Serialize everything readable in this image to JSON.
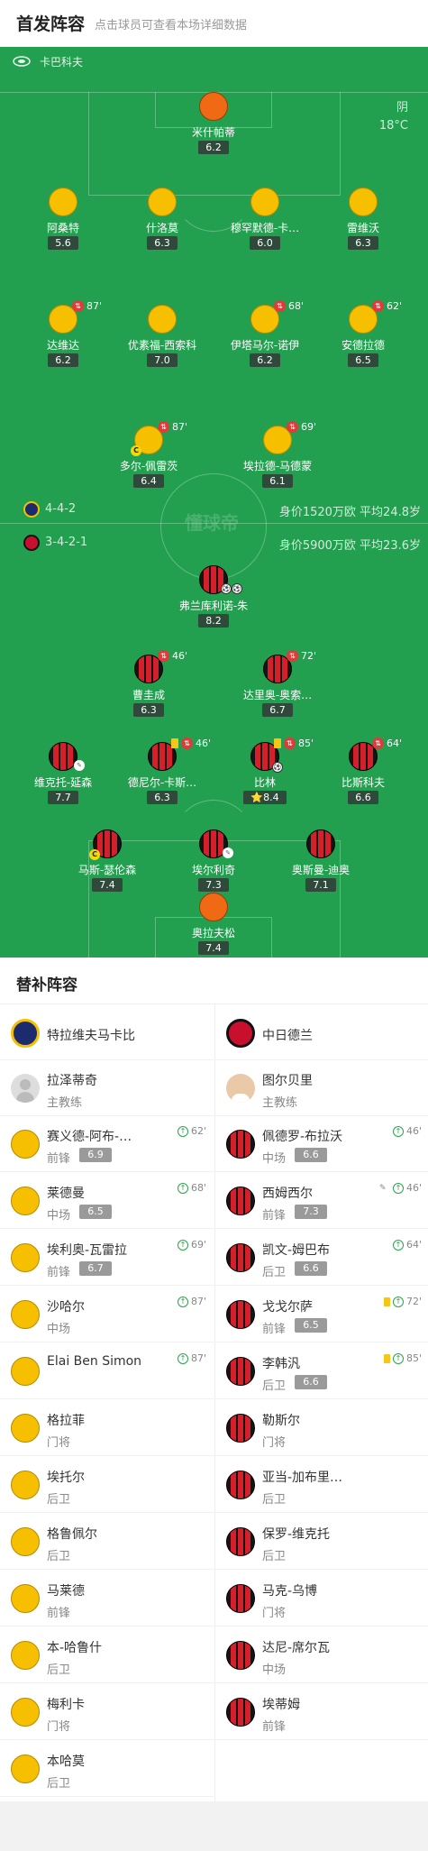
{
  "header": {
    "title": "首发阵容",
    "subtitle": "点击球员可查看本场详细数据"
  },
  "stadium": {
    "name": "卡巴科夫"
  },
  "weather": {
    "condition": "阴",
    "temperature": "18°C"
  },
  "watermark": "懂球帝",
  "home": {
    "name": "特拉维夫马卡比",
    "formation": "4-4-2",
    "info": "身价1520万欧 平均24.8岁",
    "colors": {
      "shirt": "#f6bf00",
      "keeper": "#f06a16"
    },
    "coach": {
      "name": "拉泽蒂奇",
      "role": "主教练"
    },
    "keeper": {
      "name": "米什帕蒂",
      "score": "6.2"
    },
    "defenders": [
      {
        "name": "阿桑特",
        "score": "5.6"
      },
      {
        "name": "什洛莫",
        "score": "6.3"
      },
      {
        "name": "穆罕默德-卡…",
        "score": "6.0"
      },
      {
        "name": "雷维沃",
        "score": "6.3"
      }
    ],
    "midfielders": [
      {
        "name": "达维达",
        "score": "6.2",
        "sub_min": "87'"
      },
      {
        "name": "优素福-西索科",
        "score": "7.0"
      },
      {
        "name": "伊塔马尔-诺伊",
        "score": "6.2",
        "sub_min": "68'"
      },
      {
        "name": "安德拉德",
        "score": "6.5",
        "sub_min": "62'"
      }
    ],
    "forwards": [
      {
        "name": "多尔-佩雷茨",
        "score": "6.4",
        "sub_min": "87'",
        "captain": "C"
      },
      {
        "name": "埃拉德-马德蒙",
        "score": "6.1",
        "sub_min": "69'"
      }
    ]
  },
  "away": {
    "name": "中日德兰",
    "formation": "3-4-2-1",
    "info": "身价5900万欧 平均23.6岁",
    "colors": {
      "shirt": "#d5202c",
      "keeper": "#f06a16"
    },
    "coach": {
      "name": "图尔贝里",
      "role": "主教练"
    },
    "striker": {
      "name": "弗兰库利诺-朱",
      "score": "8.2"
    },
    "attacking_mids": [
      {
        "name": "曹圭成",
        "score": "6.3",
        "sub_min": "46'"
      },
      {
        "name": "达里奥-奥索…",
        "score": "6.7",
        "sub_min": "72'"
      }
    ],
    "midfielders": [
      {
        "name": "维克托-延森",
        "score": "7.7"
      },
      {
        "name": "德尼尔-卡斯…",
        "score": "6.3",
        "sub_min": "46'"
      },
      {
        "name": "比林",
        "score": "8.4",
        "sub_min": "85'",
        "star": "⭐"
      },
      {
        "name": "比斯科夫",
        "score": "6.6",
        "sub_min": "64'"
      }
    ],
    "defenders": [
      {
        "name": "马斯-瑟伦森",
        "score": "7.4",
        "captain": "C"
      },
      {
        "name": "埃尔利奇",
        "score": "7.3"
      },
      {
        "name": "奥斯曼-迪奥",
        "score": "7.1"
      }
    ],
    "keeper": {
      "name": "奥拉夫松",
      "score": "7.4"
    }
  },
  "bench": {
    "title": "替补阵容",
    "home": [
      {
        "name": "赛义德-阿布-…",
        "pos": "前锋",
        "score": "6.9",
        "min": "62'"
      },
      {
        "name": "莱德曼",
        "pos": "中场",
        "score": "6.5",
        "min": "68'"
      },
      {
        "name": "埃利奥-瓦雷拉",
        "pos": "前锋",
        "score": "6.7",
        "min": "69'"
      },
      {
        "name": "沙哈尔",
        "pos": "中场",
        "min": "87'"
      },
      {
        "name": "Elai Ben Simon",
        "min": "87'"
      },
      {
        "name": "格拉菲",
        "pos": "门将"
      },
      {
        "name": "埃托尔",
        "pos": "后卫"
      },
      {
        "name": "格鲁佩尔",
        "pos": "后卫"
      },
      {
        "name": "马莱德",
        "pos": "前锋"
      },
      {
        "name": "本-哈鲁什",
        "pos": "后卫"
      },
      {
        "name": "梅利卡",
        "pos": "门将"
      },
      {
        "name": "本哈莫",
        "pos": "后卫"
      }
    ],
    "away": [
      {
        "name": "佩德罗-布拉沃",
        "pos": "中场",
        "score": "6.6",
        "min": "46'"
      },
      {
        "name": "西姆西尔",
        "pos": "前锋",
        "score": "7.3",
        "min": "46'",
        "whistle": true
      },
      {
        "name": "凯文-姆巴布",
        "pos": "后卫",
        "score": "6.6",
        "min": "64'"
      },
      {
        "name": "戈戈尔萨",
        "pos": "前锋",
        "score": "6.5",
        "min": "72'",
        "yellow": true
      },
      {
        "name": "李韩汎",
        "pos": "后卫",
        "score": "6.6",
        "min": "85'",
        "yellow": true
      },
      {
        "name": "勒斯尔",
        "pos": "门将"
      },
      {
        "name": "亚当-加布里…",
        "pos": "后卫"
      },
      {
        "name": "保罗-维克托",
        "pos": "后卫"
      },
      {
        "name": "马克-乌博",
        "pos": "门将"
      },
      {
        "name": "达尼-席尔瓦",
        "pos": "中场"
      },
      {
        "name": "埃蒂姆",
        "pos": "前锋"
      }
    ]
  }
}
